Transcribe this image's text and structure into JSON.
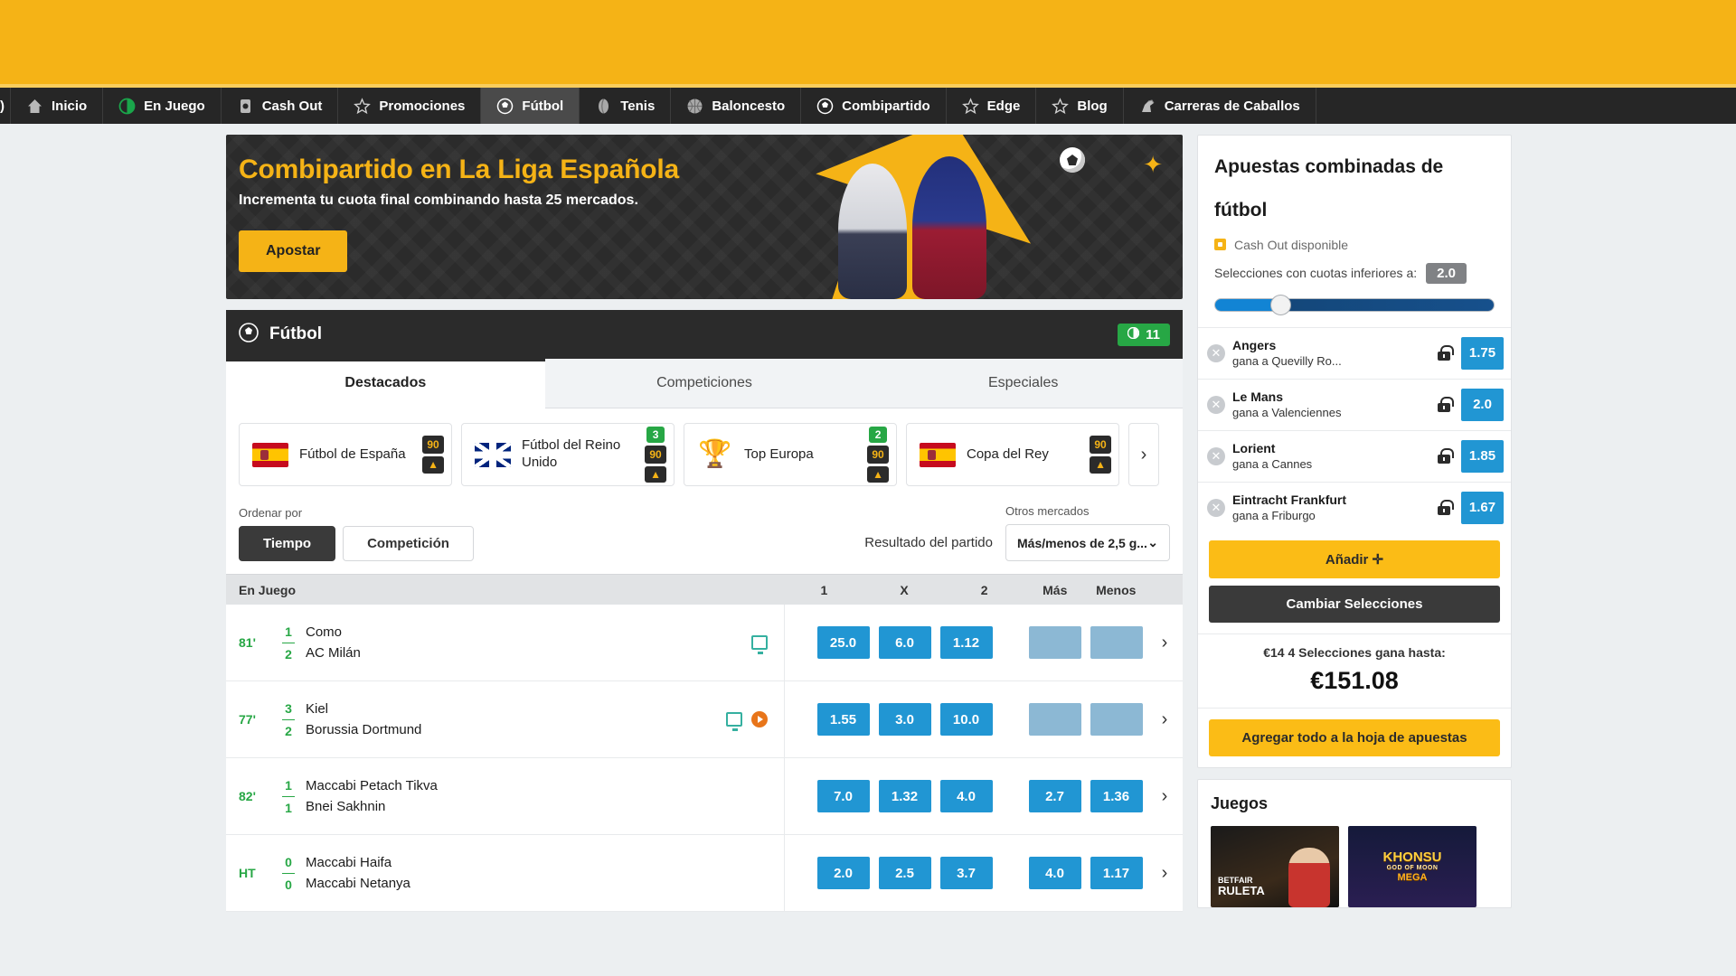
{
  "nav": {
    "prefix": ")",
    "items": [
      {
        "label": "Inicio",
        "icon": "home-icon",
        "active": false
      },
      {
        "label": "En Juego",
        "icon": "live-clock-icon",
        "active": false
      },
      {
        "label": "Cash Out",
        "icon": "cashout-icon",
        "active": false
      },
      {
        "label": "Promociones",
        "icon": "star-icon",
        "active": false
      },
      {
        "label": "Fútbol",
        "icon": "football-icon",
        "active": true
      },
      {
        "label": "Tenis",
        "icon": "tennis-icon",
        "active": false
      },
      {
        "label": "Baloncesto",
        "icon": "basketball-icon",
        "active": false
      },
      {
        "label": "Combipartido",
        "icon": "football-icon",
        "active": false
      },
      {
        "label": "Edge",
        "icon": "star-icon",
        "active": false
      },
      {
        "label": "Blog",
        "icon": "star-icon",
        "active": false
      },
      {
        "label": "Carreras de Caballos",
        "icon": "horse-icon",
        "active": false
      }
    ]
  },
  "promo": {
    "title": "Combipartido en La Liga Española",
    "subtitle": "Incrementa tu cuota final combinando hasta 25 mercados.",
    "button": "Apostar"
  },
  "sport_header": {
    "title": "Fútbol",
    "live_count": "11"
  },
  "tabs": [
    {
      "label": "Destacados",
      "active": true
    },
    {
      "label": "Competiciones",
      "active": false
    },
    {
      "label": "Especiales",
      "active": false
    }
  ],
  "leagues": [
    {
      "name": "Fútbol de España",
      "flag": "flag-es",
      "live": "",
      "badge90": "90",
      "up": "▲"
    },
    {
      "name": "Fútbol del Reino Unido",
      "flag": "flag-uk",
      "live": "3",
      "badge90": "90",
      "up": "▲"
    },
    {
      "name": "Top Europa",
      "flag": "trophy",
      "live": "2",
      "badge90": "90",
      "up": "▲"
    },
    {
      "name": "Copa del Rey",
      "flag": "flag-es",
      "live": "",
      "badge90": "90",
      "up": "▲"
    }
  ],
  "sort": {
    "label": "Ordenar por",
    "options": [
      {
        "label": "Tiempo",
        "active": true
      },
      {
        "label": "Competición",
        "active": false
      }
    ],
    "market_label": "Resultado del partido",
    "other_markets_label": "Otros mercados",
    "other_markets_value": "Más/menos de 2,5 g..."
  },
  "table": {
    "headers": {
      "left": "En Juego",
      "one": "1",
      "x": "X",
      "two": "2",
      "more": "Más",
      "less": "Menos"
    },
    "rows": [
      {
        "time": "81'",
        "score_home": "1",
        "score_away": "2",
        "home": "Como",
        "away": "AC Milán",
        "has_tv": true,
        "has_play": false,
        "odds": [
          "25.0",
          "6.0",
          "1.12"
        ],
        "ou": [
          "",
          ""
        ],
        "ou_muted": true
      },
      {
        "time": "77'",
        "score_home": "3",
        "score_away": "2",
        "home": "Kiel",
        "away": "Borussia Dortmund",
        "has_tv": true,
        "has_play": true,
        "odds": [
          "1.55",
          "3.0",
          "10.0"
        ],
        "ou": [
          "",
          ""
        ],
        "ou_muted": true
      },
      {
        "time": "82'",
        "score_home": "1",
        "score_away": "1",
        "home": "Maccabi Petach Tikva",
        "away": "Bnei Sakhnin",
        "has_tv": false,
        "has_play": false,
        "odds": [
          "7.0",
          "1.32",
          "4.0"
        ],
        "ou": [
          "2.7",
          "1.36"
        ],
        "ou_muted": false
      },
      {
        "time": "HT",
        "score_home": "0",
        "score_away": "0",
        "home": "Maccabi Haifa",
        "away": "Maccabi Netanya",
        "has_tv": false,
        "has_play": false,
        "odds": [
          "2.0",
          "2.5",
          "3.7"
        ],
        "ou": [
          "4.0",
          "1.17"
        ],
        "ou_muted": false
      }
    ]
  },
  "betslip": {
    "title_line1": "Apuestas combinadas de",
    "title_line2": "fútbol",
    "cashout": "Cash Out disponible",
    "slider_label": "Selecciones con cuotas inferiores a:",
    "slider_value": "2.0",
    "selections": [
      {
        "team": "Angers",
        "detail": "gana a Quevilly Ro...",
        "odd": "1.75"
      },
      {
        "team": "Le Mans",
        "detail": "gana a Valenciennes",
        "odd": "2.0"
      },
      {
        "team": "Lorient",
        "detail": "gana a Cannes",
        "odd": "1.85"
      },
      {
        "team": "Eintracht Frankfurt",
        "detail": "gana a Friburgo",
        "odd": "1.67"
      }
    ],
    "add_button": "Añadir  ✛",
    "change_button": "Cambiar Selecciones",
    "payout_line": "€14 4 Selecciones gana hasta:",
    "payout_amount": "€151.08",
    "add_all_button": "Agregar todo a la hoja de apuestas"
  },
  "games": {
    "title": "Juegos",
    "tiles": [
      {
        "name": "RULETA",
        "sub": "BETFAIR",
        "type": "roulette"
      },
      {
        "name": "KHONSU",
        "sub": "GOD OF MOON",
        "extra": "MEGA",
        "type": "khonsu"
      }
    ]
  },
  "colors": {
    "brand_yellow": "#f5b316",
    "odds_blue": "#2196d3",
    "live_green": "#27a745",
    "dark": "#2b2b2b"
  }
}
